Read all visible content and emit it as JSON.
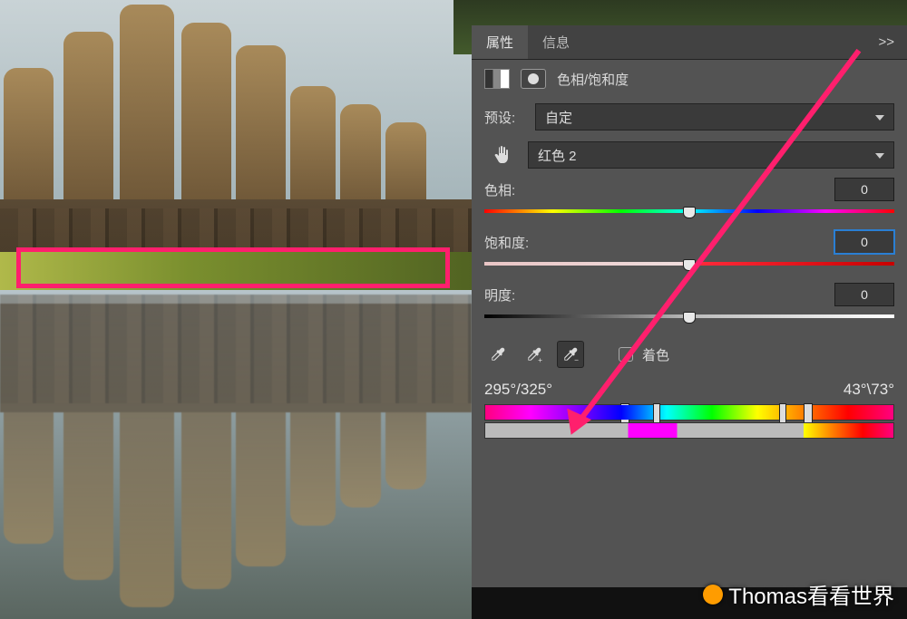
{
  "tabs": {
    "properties": "属性",
    "info": "信息",
    "expand": ">>"
  },
  "adjustment": {
    "title": "色相/饱和度"
  },
  "preset": {
    "label": "预设:",
    "value": "自定"
  },
  "channel": {
    "value": "红色 2"
  },
  "sliders": {
    "hue": {
      "label": "色相:",
      "value": "0"
    },
    "saturation": {
      "label": "饱和度:",
      "value": "0"
    },
    "lightness": {
      "label": "明度:",
      "value": "0"
    }
  },
  "colorize": {
    "label": "着色"
  },
  "range": {
    "left": "295°/325°",
    "right": "43°\\73°"
  },
  "watermark": "Thomas看看世界"
}
